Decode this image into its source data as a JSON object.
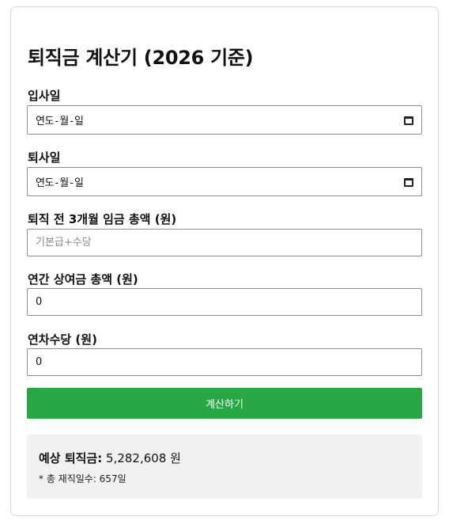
{
  "title": "퇴직금 계산기 (2026 기준)",
  "fields": {
    "hire_date": {
      "label": "입사일",
      "display": "연도-월-일"
    },
    "leave_date": {
      "label": "퇴사일",
      "display": "연도-월-일"
    },
    "wage_3m": {
      "label": "퇴직 전 3개월 임금 총액 (원)",
      "placeholder": "기본급+수당",
      "value": ""
    },
    "bonus": {
      "label": "연간 상여금 총액 (원)",
      "value": "0"
    },
    "annual_leave": {
      "label": "연차수당 (원)",
      "value": "0"
    }
  },
  "calculate_button": "계산하기",
  "result": {
    "label": "예상 퇴직금:",
    "value": "5,282,608 원",
    "days_note": "* 총 재직일수: 657일"
  },
  "colors": {
    "button": "#28a745",
    "result_bg": "#f1f1f1"
  }
}
